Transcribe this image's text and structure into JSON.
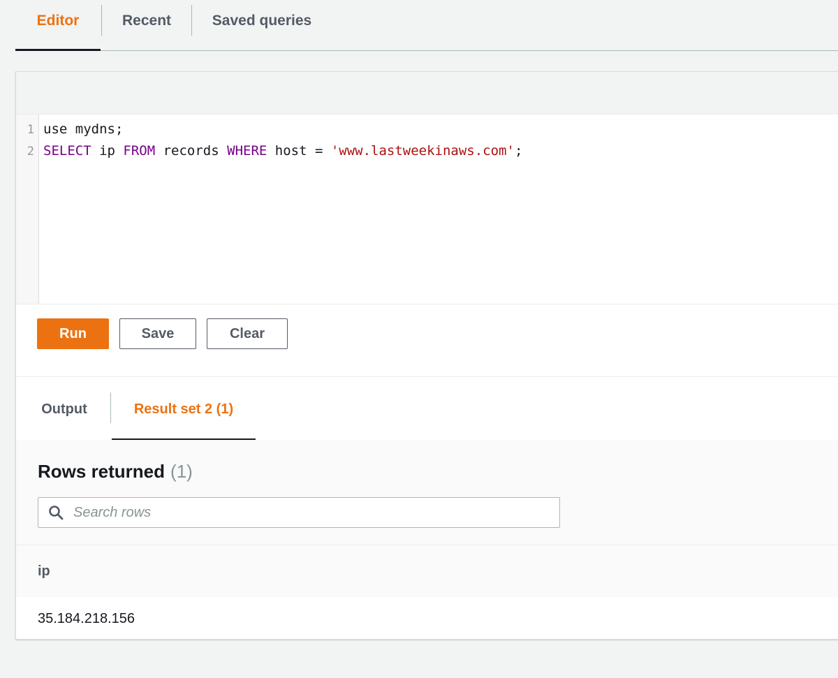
{
  "top_tabs": {
    "editor": "Editor",
    "recent": "Recent",
    "saved": "Saved queries"
  },
  "editor": {
    "line1_num": "1",
    "line2_num": "2",
    "line1_text": "use mydns;",
    "line2": {
      "kw_select": "SELECT",
      "t1": " ip ",
      "kw_from": "FROM",
      "t2": " records ",
      "kw_where": "WHERE",
      "t3": " host = ",
      "string": "'www.lastweekinaws.com'",
      "t4": ";"
    }
  },
  "buttons": {
    "run": "Run",
    "save": "Save",
    "clear": "Clear"
  },
  "result_tabs": {
    "output": "Output",
    "result_set": "Result set 2 (1)"
  },
  "results": {
    "title": "Rows returned",
    "count": "(1)",
    "search_placeholder": "Search rows",
    "columns": [
      "ip"
    ],
    "rows": [
      [
        "35.184.218.156"
      ]
    ]
  },
  "colors": {
    "accent": "#ec7211",
    "keyword": "#770088",
    "string": "#aa1111"
  }
}
